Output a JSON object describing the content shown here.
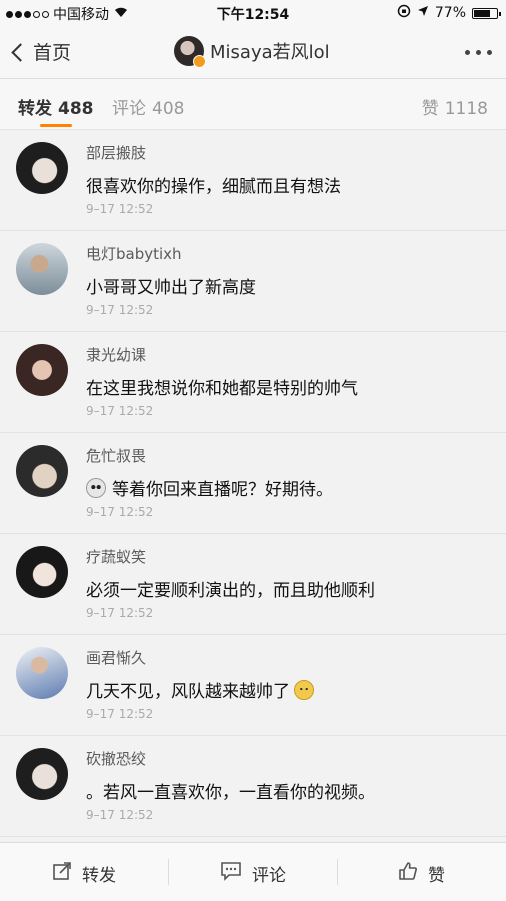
{
  "status_bar": {
    "carrier": "中国移动",
    "time": "下午12:54",
    "battery": "77%",
    "battery_level": 0.77
  },
  "nav": {
    "back_label": "首页",
    "title": "Misaya若风lol"
  },
  "tabs": [
    {
      "label": "转发",
      "count": "488"
    },
    {
      "label": "评论",
      "count": "408"
    },
    {
      "label": "赞",
      "count": "1118"
    }
  ],
  "comments": [
    {
      "name": "部层搬肢",
      "text": "很喜欢你的操作，细腻而且有想法",
      "time": "9–17 12:52"
    },
    {
      "name": "电灯babytixh",
      "text": "小哥哥又帅出了新高度",
      "time": "9–17 12:52"
    },
    {
      "name": "隶光幼课",
      "text": "在这里我想说你和她都是特别的帅气",
      "time": "9–17 12:52"
    },
    {
      "name": "危忙叔畏",
      "text": "等着你回来直播呢？好期待。",
      "time": "9–17 12:52",
      "emoji": "panda-emoji"
    },
    {
      "name": "疗蔬蚁笑",
      "text": "必须一定要顺利演出的，而且助他顺利",
      "time": "9–17 12:52"
    },
    {
      "name": "画君惭久",
      "text": "几天不见，风队越来越帅了",
      "time": "9–17 12:52",
      "emoji": "doge-emoji"
    },
    {
      "name": "砍撤恐绞",
      "text": "。若风一直喜欢你，一直看你的视频。",
      "time": "9–17 12:52"
    }
  ],
  "bottom_bar": {
    "repost": "转发",
    "comment": "评论",
    "like": "赞"
  },
  "colors": {
    "accent": "#ff8200",
    "badge": "#f29b1d"
  }
}
